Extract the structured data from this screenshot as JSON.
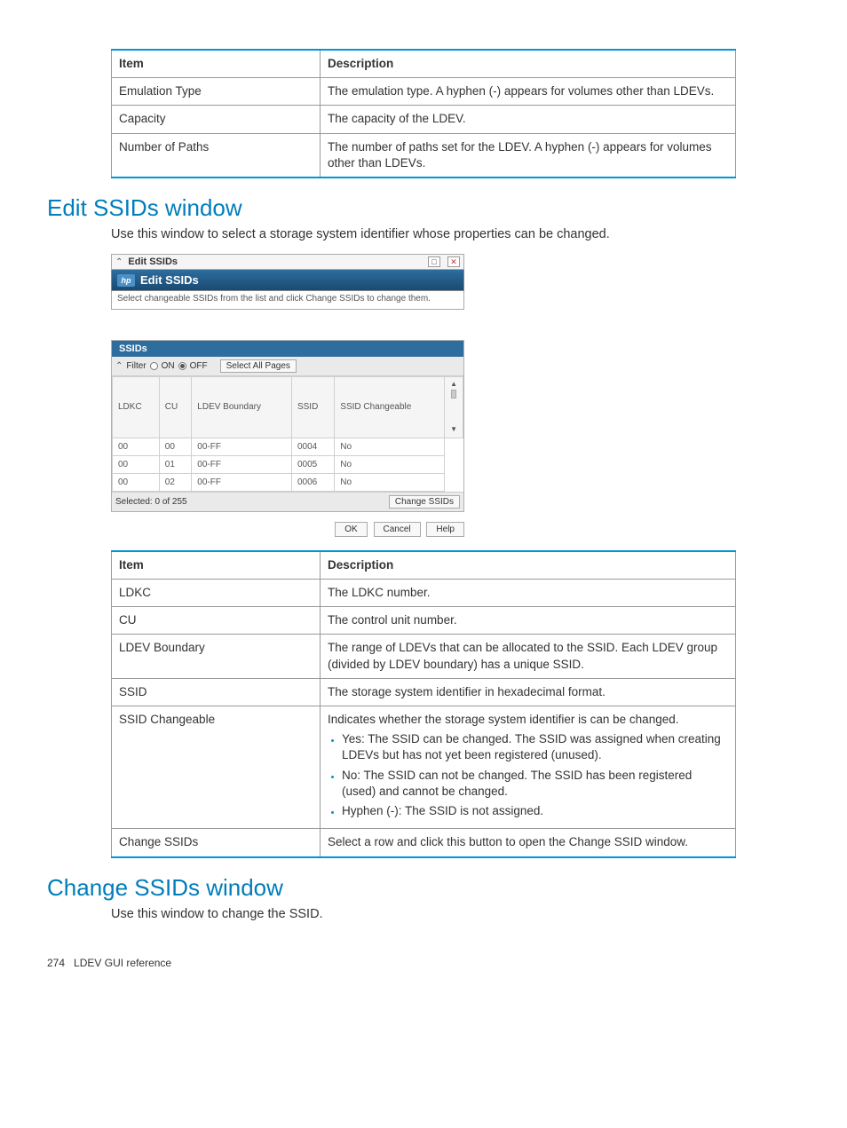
{
  "table1": {
    "header": {
      "item": "Item",
      "desc": "Description"
    },
    "rows": [
      {
        "item": "Emulation Type",
        "desc_plain": "The emulation type. A hyphen (-) appears for volumes other than LDEVs."
      },
      {
        "item": "Capacity",
        "desc_plain": "The capacity of the LDEV."
      },
      {
        "item": "Number of Paths",
        "desc_plain": "The number of paths set for the LDEV. A hyphen (-) appears for volumes other than LDEVs."
      }
    ]
  },
  "section1": {
    "title": "Edit SSIDs window",
    "intro": "Use this window to select a storage system identifier whose properties can be changed."
  },
  "dialog": {
    "titlebar": "Edit SSIDs",
    "header": "Edit SSIDs",
    "instruction": "Select changeable SSIDs from the list and click Change SSIDs to change them.",
    "panel_title": "SSIDs",
    "filter_label": "Filter",
    "on_label": "ON",
    "off_label": "OFF",
    "select_all_label": "Select All Pages",
    "columns": {
      "ldkc": "LDKC",
      "cu": "CU",
      "ldev_boundary": "LDEV Boundary",
      "ssid": "SSID",
      "ssid_changeable": "SSID Changeable"
    },
    "rows": [
      {
        "ldkc": "00",
        "cu": "00",
        "ldev_boundary": "00-FF",
        "ssid": "0004",
        "ssid_changeable": "No"
      },
      {
        "ldkc": "00",
        "cu": "01",
        "ldev_boundary": "00-FF",
        "ssid": "0005",
        "ssid_changeable": "No"
      },
      {
        "ldkc": "00",
        "cu": "02",
        "ldev_boundary": "00-FF",
        "ssid": "0006",
        "ssid_changeable": "No"
      }
    ],
    "selected_text": "Selected:  0   of  255",
    "change_btn": "Change SSIDs",
    "ok": "OK",
    "cancel": "Cancel",
    "help": "Help"
  },
  "table2": {
    "header": {
      "item": "Item",
      "desc": "Description"
    },
    "rows": [
      {
        "item": "LDKC",
        "desc_plain": "The LDKC number."
      },
      {
        "item": "CU",
        "desc_plain": "The control unit number."
      },
      {
        "item": "LDEV Boundary",
        "desc_plain": "The range of LDEVs that can be allocated to the SSID. Each LDEV group (divided by LDEV boundary) has a unique SSID."
      },
      {
        "item": "SSID",
        "desc_plain": "The storage system identifier in hexadecimal format."
      },
      {
        "item": "SSID Changeable",
        "desc_lead": "Indicates whether the storage system identifier is can be changed.",
        "bullets": [
          "Yes: The SSID can be changed. The SSID was assigned when creating LDEVs but has not yet been registered (unused).",
          "No: The SSID can not be changed. The SSID has been registered (used) and cannot be changed.",
          "Hyphen (-): The SSID is not assigned."
        ]
      },
      {
        "item": "Change SSIDs",
        "desc_plain": "Select a row and click this button to open the Change SSID window."
      }
    ]
  },
  "section2": {
    "title": "Change SSIDs window",
    "intro": "Use this window to change the SSID."
  },
  "footer": {
    "page_num": "274",
    "chapter": "LDEV GUI reference"
  }
}
